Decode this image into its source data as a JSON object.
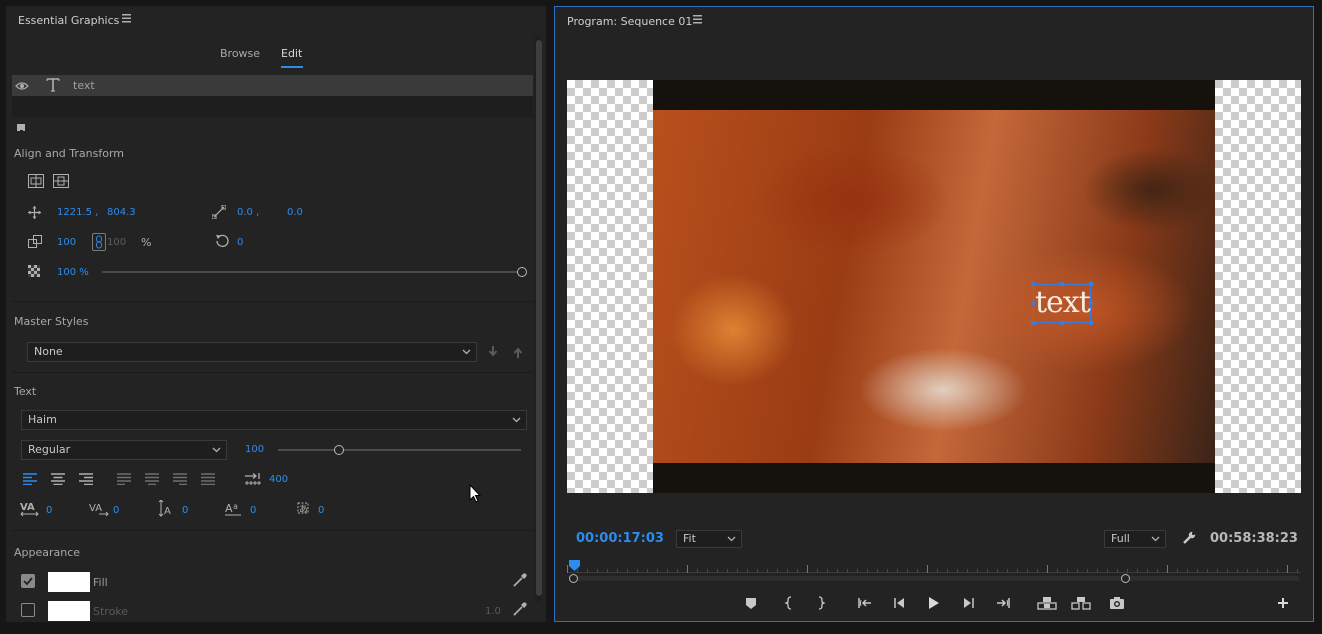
{
  "essential_graphics": {
    "title": "Essential Graphics",
    "tabs": {
      "browse": "Browse",
      "edit": "Edit",
      "active": "Edit"
    },
    "layer": {
      "name": "text"
    },
    "align_transform": {
      "title": "Align and Transform",
      "position_x": "1221.5 ,",
      "position_y": "804.3",
      "anchor_x": "0.0 ,",
      "anchor_y": "0.0",
      "scale": "100",
      "scale_linked": "100",
      "scale_unit": "%",
      "rotation": "0",
      "opacity": "100 %",
      "opacity_fraction": 1.0
    },
    "master_styles": {
      "title": "Master Styles",
      "value": "None"
    },
    "text": {
      "title": "Text",
      "font": "Haim",
      "style": "Regular",
      "size": "100",
      "tab_width": "400",
      "kerning": "0",
      "tracking": "0",
      "leading": "0",
      "baseline_shift": "0",
      "tsume": "0"
    },
    "appearance": {
      "title": "Appearance",
      "fill_label": "Fill",
      "fill_checked": true,
      "fill_color": "#ffffff",
      "stroke_label": "Stroke",
      "stroke_checked": false,
      "stroke_color": "#ffffff",
      "stroke_width": "1.0"
    }
  },
  "program_monitor": {
    "title": "Program: Sequence 01",
    "canvas_text": "text",
    "timecode": "00:00:17:03",
    "zoom": "Fit",
    "resolution": "Full",
    "duration": "00:58:38:23"
  },
  "colors": {
    "accent": "#2d8ceb",
    "panel": "#232323",
    "monitor_border": "#2d6fc1"
  }
}
